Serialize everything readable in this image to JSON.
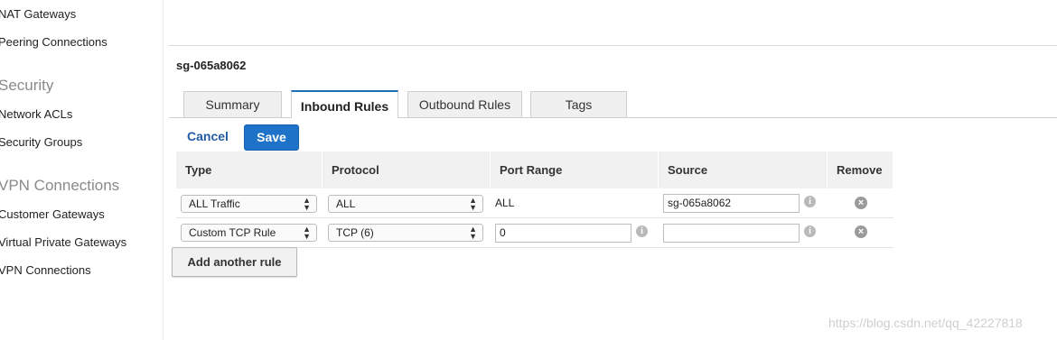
{
  "sidebar": {
    "items": [
      {
        "label": "NAT Gateways"
      },
      {
        "label": "Peering Connections"
      },
      {
        "heading": "Security"
      },
      {
        "label": "Network ACLs"
      },
      {
        "label": "Security Groups"
      },
      {
        "heading": "VPN Connections"
      },
      {
        "label": "Customer Gateways"
      },
      {
        "label": "Virtual Private Gateways"
      },
      {
        "label": "VPN Connections"
      }
    ]
  },
  "security_group": {
    "id": "sg-065a8062"
  },
  "tabs": [
    {
      "label": "Summary",
      "active": false
    },
    {
      "label": "Inbound Rules",
      "active": true
    },
    {
      "label": "Outbound Rules",
      "active": false
    },
    {
      "label": "Tags",
      "active": false
    }
  ],
  "actions": {
    "cancel_label": "Cancel",
    "save_label": "Save"
  },
  "table": {
    "columns": [
      "Type",
      "Protocol",
      "Port Range",
      "Source",
      "Remove"
    ],
    "rows": [
      {
        "type": "ALL Traffic",
        "protocol": "ALL",
        "port_range": "ALL",
        "source": "sg-065a8062"
      },
      {
        "type": "Custom TCP Rule",
        "protocol": "TCP (6)",
        "port_range": "0",
        "source": ""
      }
    ]
  },
  "add_rule_label": "Add another rule",
  "watermark": "https://blog.csdn.net/qq_42227818",
  "colors": {
    "accent": "#1e73c8",
    "link": "#1f5aa8"
  }
}
